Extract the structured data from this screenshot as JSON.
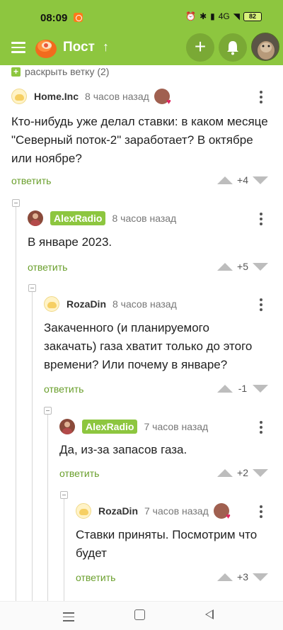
{
  "status_bar": {
    "time": "08:09",
    "battery": "82",
    "network": "4G"
  },
  "app_bar": {
    "title": "Пост"
  },
  "thread": {
    "expand_label": "раскрыть ветку (2)"
  },
  "comments": [
    {
      "author": "Home.Inc",
      "time": "8 часов назад",
      "text": "Кто-нибудь уже делал ставки: в каком месяце \"Северный поток-2\" заработает? В октябре или ноябре?",
      "reply": "ответить",
      "score": "+4"
    },
    {
      "author": "AlexRadio",
      "time": "8 часов назад",
      "text": "В январе 2023.",
      "reply": "ответить",
      "score": "+5"
    },
    {
      "author": "RozaDin",
      "time": "8 часов назад",
      "text": "Закаченного (и планируемого закачать) газа хватит только до этого времени? Или почему в январе?",
      "reply": "ответить",
      "score": "-1"
    },
    {
      "author": "AlexRadio",
      "time": "7 часов назад",
      "text": "Да, из-за запасов газа.",
      "reply": "ответить",
      "score": "+2"
    },
    {
      "author": "RozaDin",
      "time": "7 часов назад",
      "text": "Ставки приняты. Посмотрим что будет",
      "reply": "ответить",
      "score": "+3"
    }
  ],
  "colors": {
    "accent": "#8dc63f",
    "reply_link": "#6a9f2c"
  }
}
